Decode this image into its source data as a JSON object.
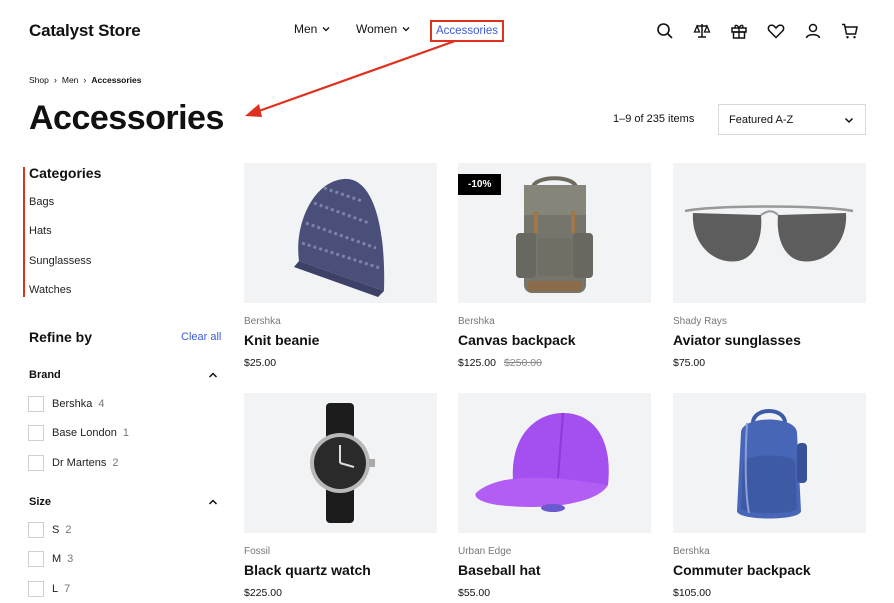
{
  "header": {
    "logo": "Catalyst Store",
    "nav": [
      {
        "label": "Men"
      },
      {
        "label": "Women"
      },
      {
        "label": "Accessories"
      }
    ],
    "icons": [
      "search-icon",
      "compare-icon",
      "gift-icon",
      "heart-icon",
      "account-icon",
      "cart-icon"
    ]
  },
  "breadcrumb": [
    "Shop",
    "Men",
    "Accessories"
  ],
  "page": {
    "title": "Accessories",
    "count": "1–9 of 235 items",
    "sort": "Featured A-Z"
  },
  "sidebar": {
    "categories_title": "Categories",
    "categories": [
      "Bags",
      "Hats",
      "Sunglassess",
      "Watches"
    ],
    "refine_title": "Refine by",
    "clear_all": "Clear all",
    "brand": {
      "title": "Brand",
      "options": [
        {
          "label": "Bershka",
          "count": "4"
        },
        {
          "label": "Base London",
          "count": "1"
        },
        {
          "label": "Dr Martens",
          "count": "2"
        }
      ]
    },
    "size": {
      "title": "Size",
      "options": [
        {
          "label": "S",
          "count": "2"
        },
        {
          "label": "M",
          "count": "3"
        },
        {
          "label": "L",
          "count": "7"
        }
      ]
    }
  },
  "products": [
    {
      "brand": "Bershka",
      "name": "Knit beanie",
      "price": "$25.00"
    },
    {
      "brand": "Bershka",
      "name": "Canvas backpack",
      "price": "$125.00",
      "old_price": "$250.00",
      "badge": "-10%"
    },
    {
      "brand": "Shady Rays",
      "name": "Aviator sunglasses",
      "price": "$75.00"
    },
    {
      "brand": "Fossil",
      "name": "Black quartz watch",
      "price": "$225.00"
    },
    {
      "brand": "Urban Edge",
      "name": "Baseball hat",
      "price": "$55.00"
    },
    {
      "brand": "Bershka",
      "name": "Commuter backpack",
      "price": "$105.00"
    }
  ],
  "colors": {
    "accent": "#3b5bdb",
    "annotation": "#e0301e"
  }
}
